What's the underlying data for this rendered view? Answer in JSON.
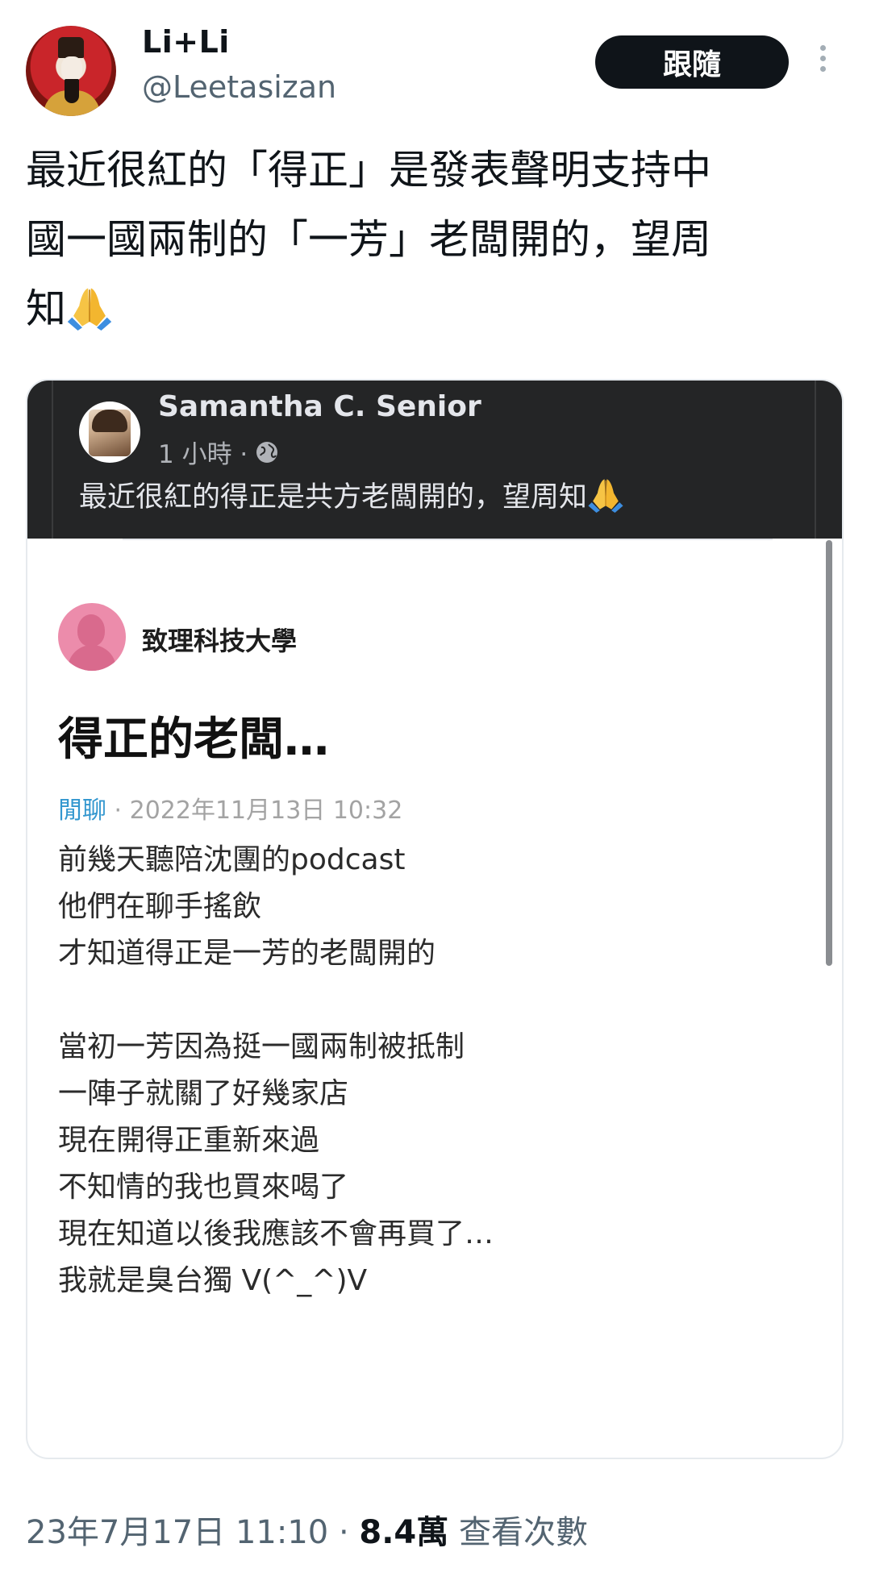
{
  "author": {
    "display_name": "Li+Li",
    "handle": "@Leetasizan",
    "follow_label": "跟隨"
  },
  "tweet": {
    "text": "最近很紅的「得正」是發表聲明支持中\n國一國兩制的「一芳」老闆開的，望周\n知"
  },
  "embedded": {
    "fb_post": {
      "author": "Samantha C. Senior",
      "time": "1 小時 ·",
      "text": "最近很紅的得正是共方老闆開的，望周知"
    },
    "dcard": {
      "school": "致理科技大學",
      "title": "得正的老闆…",
      "board": "閒聊",
      "meta_separator": " · ",
      "datetime": "2022年11月13日 10:32",
      "lines": [
        "前幾天聽陪沈團的podcast",
        "他們在聊手搖飲",
        "才知道得正是一芳的老闆開的",
        "",
        "當初一芳因為挺一國兩制被抵制",
        "一陣子就關了好幾家店",
        "現在開得正重新來過",
        "不知情的我也買來喝了",
        "現在知道以後我應該不會再買了…",
        "我就是臭台獨 V(^_^)V"
      ]
    }
  },
  "footer": {
    "timestamp": "23年7月17日 11:10",
    "separator": " · ",
    "views": "8.4萬",
    "views_label": " 查看次數"
  },
  "icons": [
    "more-vertical-icon",
    "pray-icon",
    "globe-icon"
  ],
  "colors": {
    "follow_button_bg": "#0f1419",
    "secondary_text": "#536471",
    "fb_bg": "#242526",
    "dcard_avatar": "#ec8cab",
    "board_link": "#3397cf"
  }
}
